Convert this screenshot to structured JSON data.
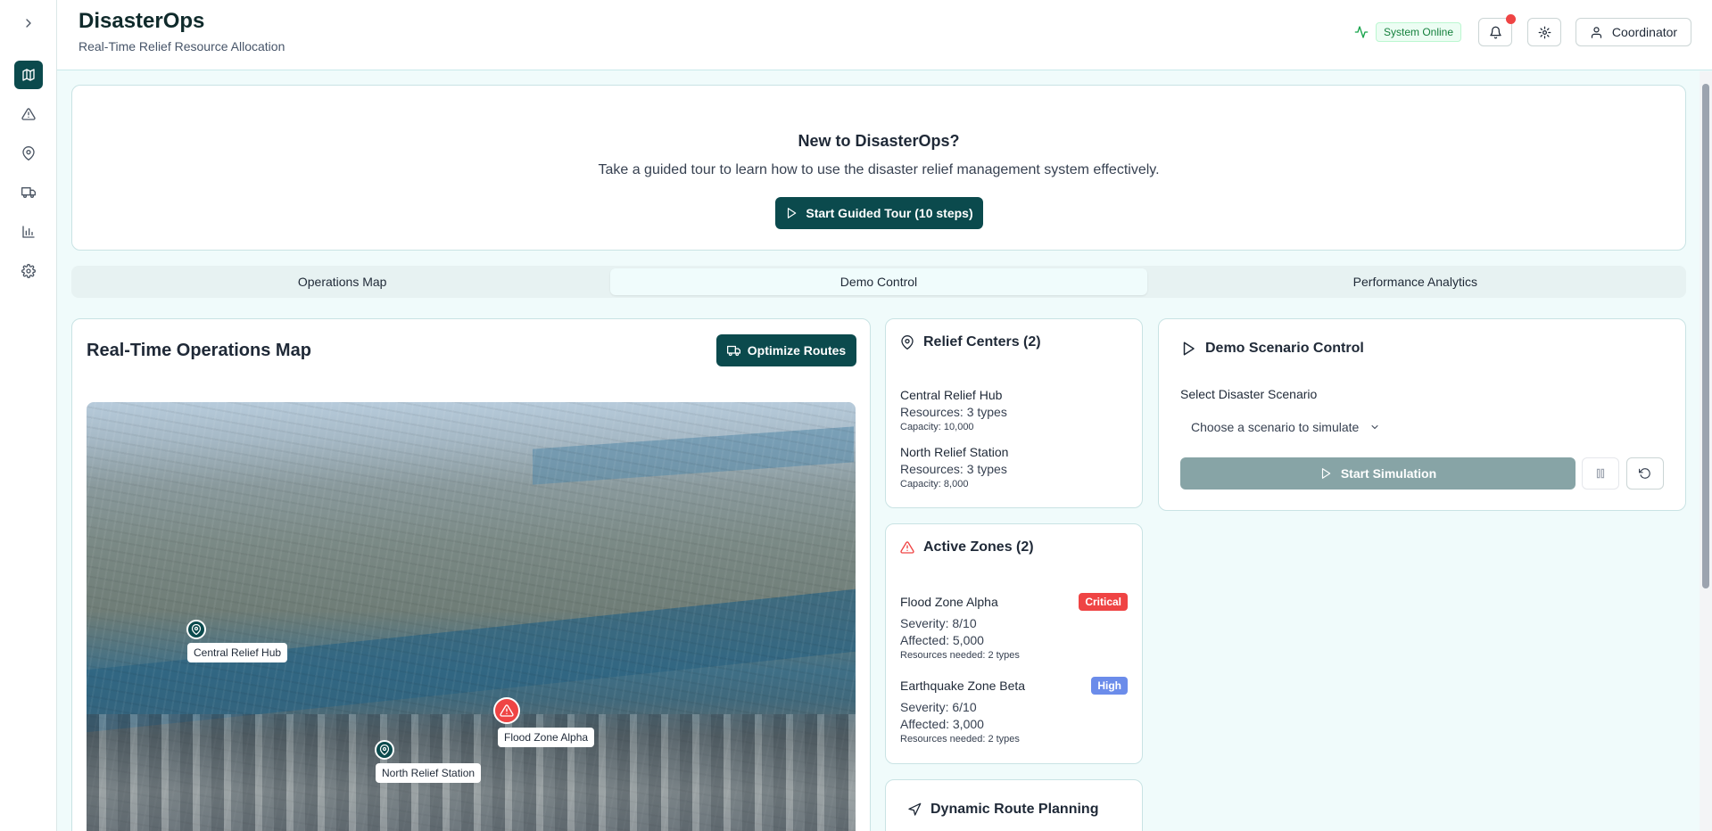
{
  "app": {
    "title": "DisasterOps",
    "subtitle": "Real-Time Relief Resource Allocation"
  },
  "sidebar": {
    "items": [
      {
        "icon": "chevron-right-icon"
      },
      {
        "icon": "map-icon",
        "active": true
      },
      {
        "icon": "alert-triangle-icon"
      },
      {
        "icon": "map-pin-icon"
      },
      {
        "icon": "truck-icon"
      },
      {
        "icon": "bar-chart-icon"
      },
      {
        "icon": "gear-icon"
      }
    ]
  },
  "header": {
    "status_label": "System Online",
    "user_label": "Coordinator"
  },
  "tour": {
    "title": "New to DisasterOps?",
    "description": "Take a guided tour to learn how to use the disaster relief management system effectively.",
    "button_label": "Start Guided Tour (10 steps)"
  },
  "tabs": [
    {
      "label": "Operations Map",
      "active": false
    },
    {
      "label": "Demo Control",
      "active": true
    },
    {
      "label": "Performance Analytics",
      "active": false
    }
  ],
  "map": {
    "title": "Real-Time Operations Map",
    "optimize_label": "Optimize Routes",
    "markers": [
      {
        "label": "Central Relief Hub",
        "type": "relief-center"
      },
      {
        "label": "Flood Zone Alpha",
        "type": "zone"
      },
      {
        "label": "North Relief Station",
        "type": "relief-center"
      }
    ]
  },
  "relief_centers": {
    "title": "Relief Centers (2)",
    "items": [
      {
        "name": "Central Relief Hub",
        "resources": "Resources: 3 types",
        "capacity": "Capacity: 10,000"
      },
      {
        "name": "North Relief Station",
        "resources": "Resources: 3 types",
        "capacity": "Capacity: 8,000"
      }
    ]
  },
  "active_zones": {
    "title": "Active Zones (2)",
    "items": [
      {
        "name": "Flood Zone Alpha",
        "badge": "Critical",
        "badge_color": "#ef4444",
        "severity": "Severity: 8/10",
        "affected": "Affected: 5,000",
        "needed": "Resources needed: 2 types"
      },
      {
        "name": "Earthquake Zone Beta",
        "badge": "High",
        "badge_color": "#6b8cea",
        "severity": "Severity: 6/10",
        "affected": "Affected: 3,000",
        "needed": "Resources needed: 2 types"
      }
    ]
  },
  "route_planning": {
    "title": "Dynamic Route Planning"
  },
  "demo_control": {
    "title": "Demo Scenario Control",
    "select_label": "Select Disaster Scenario",
    "select_placeholder": "Choose a scenario to simulate",
    "start_label": "Start Simulation"
  },
  "colors": {
    "primary": "#0b4a4d",
    "critical": "#ef4444",
    "high": "#6b8cea",
    "online": "#16a34a"
  }
}
